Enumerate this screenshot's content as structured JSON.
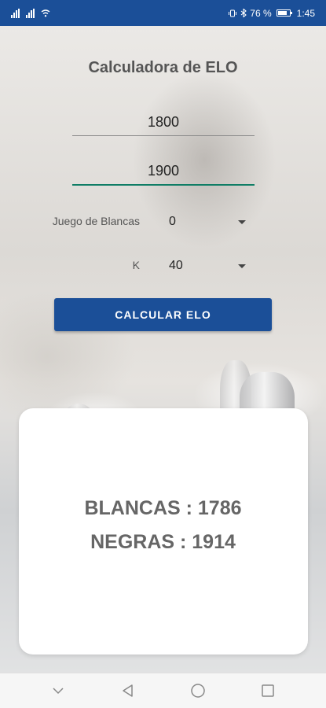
{
  "status_bar": {
    "left_icons": [
      "sim-signal-icon",
      "signal-icon",
      "wifi-icon"
    ],
    "right_icons": [
      "vibrate-icon",
      "bluetooth-icon"
    ],
    "battery_percent": "76 %",
    "time": "1:45"
  },
  "app": {
    "title": "Calculadora de ELO"
  },
  "form": {
    "rating_white": "1800",
    "rating_black": "1900",
    "game_label": "Juego de Blancas",
    "game_value": "0",
    "k_label": "K",
    "k_value": "40",
    "calculate_label": "CALCULAR ELO"
  },
  "result": {
    "white": "BLANCAS : 1786",
    "black": "NEGRAS : 1914"
  },
  "nav": {
    "items": [
      "chevron-down-icon",
      "back-icon",
      "home-icon",
      "recents-icon"
    ]
  },
  "colors": {
    "primary": "#1b4f98",
    "focus_underline": "#0f7d65",
    "result_text": "#666666"
  }
}
